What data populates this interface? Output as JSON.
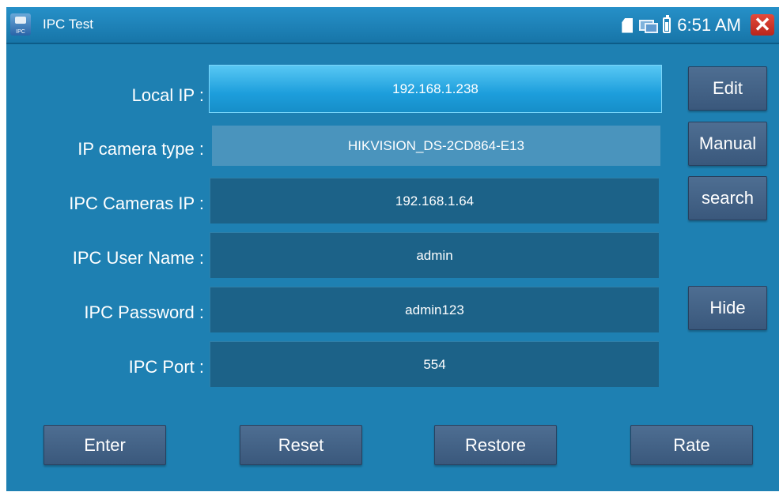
{
  "app": {
    "title": "IPC Test",
    "icon": "ipc-camera-icon",
    "icon_caption": "IPC"
  },
  "status": {
    "time": "6:51 AM",
    "icons": [
      "sd-card-icon",
      "network-icon",
      "battery-icon"
    ],
    "close_icon": "close-icon"
  },
  "form": {
    "local_ip": {
      "label": "Local IP :",
      "value": "192.168.1.238"
    },
    "camera_type": {
      "label": "IP camera type :",
      "value": "HIKVISION_DS-2CD864-E13"
    },
    "cameras_ip": {
      "label": "IPC Cameras IP :",
      "value": "192.168.1.64"
    },
    "user_name": {
      "label": "IPC User Name :",
      "value": "admin"
    },
    "password": {
      "label": "IPC Password :",
      "value": "admin123"
    },
    "port": {
      "label": "IPC Port :",
      "value": "554"
    }
  },
  "side_buttons": {
    "edit": "Edit",
    "manual": "Manual",
    "search": "search",
    "hide": "Hide"
  },
  "bottom_buttons": {
    "enter": "Enter",
    "reset": "Reset",
    "restore": "Restore",
    "rate": "Rate"
  },
  "colors": {
    "background": "#1e80b2",
    "field": "#1c6288",
    "active_field": "#1d9edc",
    "button": "#3a587c",
    "close": "#d4382a"
  }
}
